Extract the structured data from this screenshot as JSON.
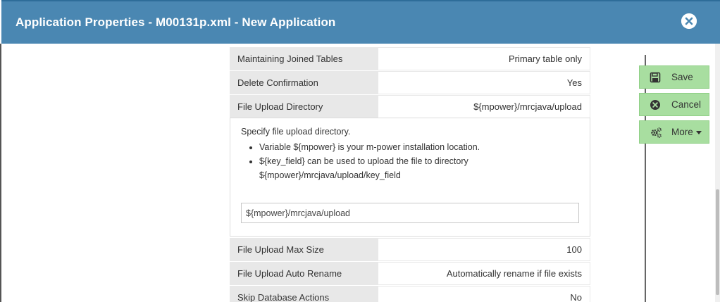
{
  "header": {
    "title": "Application Properties - M00131p.xml - New Application"
  },
  "properties": {
    "rows": [
      {
        "label": "Maintaining Joined Tables",
        "value": "Primary table only"
      },
      {
        "label": "Delete Confirmation",
        "value": "Yes"
      },
      {
        "label": "File Upload Directory",
        "value": "${mpower}/mrcjava/upload"
      },
      {
        "label": "File Upload Max Size",
        "value": "100"
      },
      {
        "label": "File Upload Auto Rename",
        "value": "Automatically rename if file exists"
      },
      {
        "label": "Skip Database Actions",
        "value": "No"
      }
    ],
    "help": {
      "intro": "Specify file upload directory.",
      "items": [
        "Variable ${mpower} is your m-power installation location.",
        "${key_field} can be used to upload the file to directory ${mpower}/mrcjava/upload/key_field"
      ]
    },
    "input_value": "${mpower}/mrcjava/upload"
  },
  "actions": {
    "save": "Save",
    "cancel": "Cancel",
    "more": "More"
  },
  "icons": {
    "close": "close-circle-icon",
    "save": "floppy-disk-icon",
    "cancel": "cancel-circle-icon",
    "more": "gears-icon"
  },
  "colors": {
    "header": "#4a87b2",
    "button": "#a8dea0",
    "row_label_bg": "#e8e8e8"
  }
}
